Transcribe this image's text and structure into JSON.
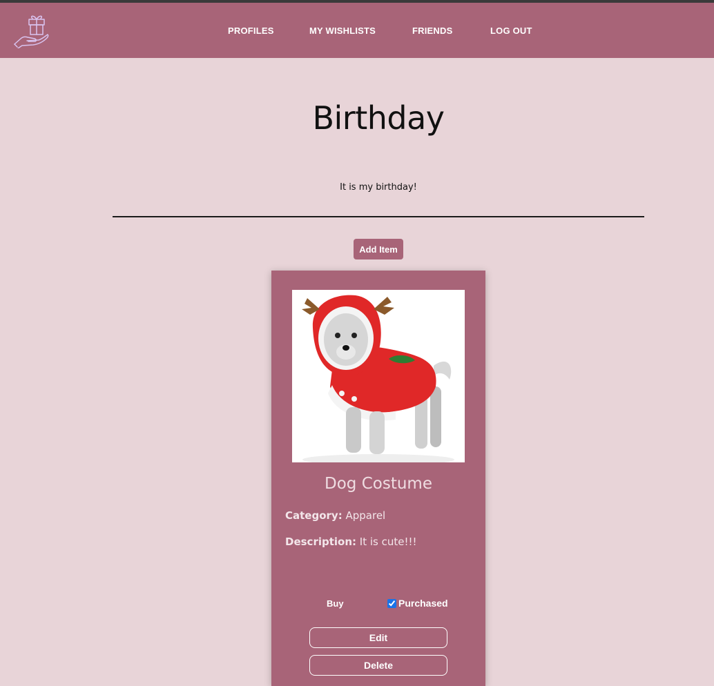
{
  "nav": {
    "items": [
      {
        "label": "PROFILES"
      },
      {
        "label": "MY WISHLISTS"
      },
      {
        "label": "FRIENDS"
      },
      {
        "label": "LOG OUT"
      }
    ]
  },
  "wishlist": {
    "title": "Birthday",
    "description": "It is my birthday!",
    "add_item_label": "Add Item"
  },
  "item": {
    "name": "Dog Costume",
    "category_label": "Category:",
    "category": "Apparel",
    "description_label": "Description:",
    "description": "It is cute!!!",
    "buy_label": "Buy",
    "purchased_label": "Purchased",
    "purchased": true,
    "edit_label": "Edit",
    "delete_label": "Delete"
  },
  "icons": {
    "logo": "hand-gift-icon"
  },
  "colors": {
    "accent": "#a86478",
    "background": "#e8d4d8"
  }
}
